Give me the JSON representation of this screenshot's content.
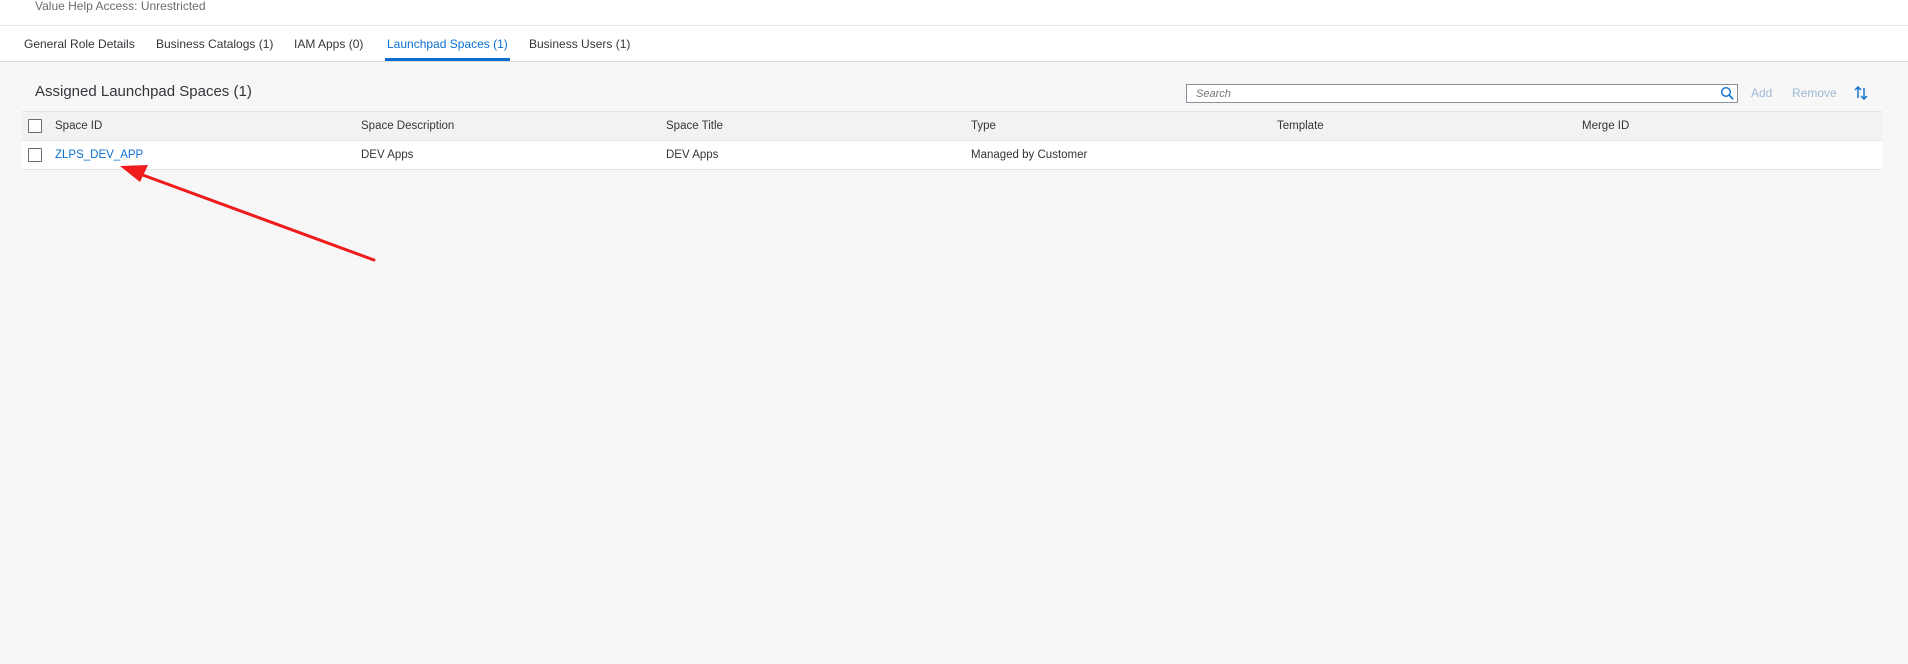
{
  "header": {
    "subtitle": "Value Help Access: Unrestricted"
  },
  "tabs": [
    {
      "label": "General Role Details"
    },
    {
      "label": "Business Catalogs (1)"
    },
    {
      "label": "IAM Apps (0)"
    },
    {
      "label": "Launchpad Spaces (1)",
      "active": true
    },
    {
      "label": "Business Users (1)"
    }
  ],
  "toolbar": {
    "title": "Assigned Launchpad Spaces (1)",
    "search_placeholder": "Search",
    "add_label": "Add",
    "remove_label": "Remove",
    "sort_icon": "sort-icon"
  },
  "table": {
    "columns": [
      "Space ID",
      "Space Description",
      "Space Title",
      "Type",
      "Template",
      "Merge ID"
    ],
    "rows": [
      {
        "space_id": "ZLPS_DEV_APP",
        "space_description": "DEV Apps",
        "space_title": "DEV Apps",
        "type": "Managed by Customer",
        "template": "",
        "merge_id": ""
      }
    ]
  },
  "colors": {
    "accent": "#0a6ed1",
    "annotation_arrow": "#ee1c1c",
    "disabled_action": "#9fb9d6"
  }
}
